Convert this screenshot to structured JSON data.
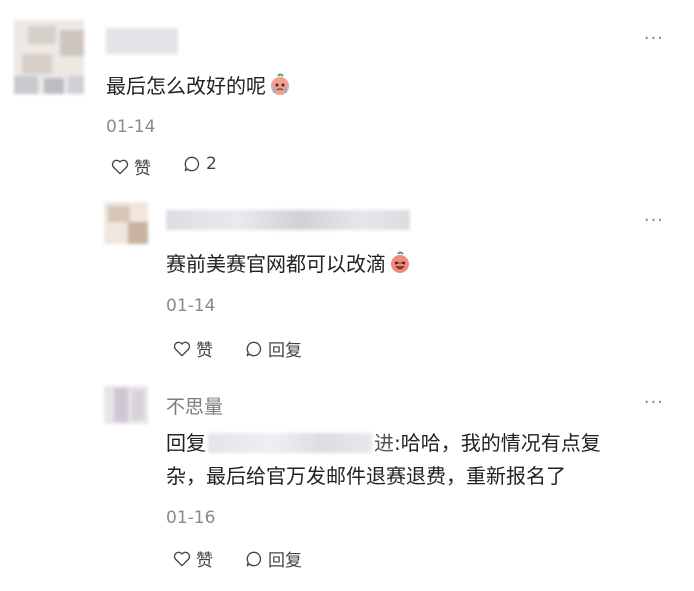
{
  "comments": [
    {
      "text": "最后怎么改好的呢",
      "emoji": "crying-peach-emoji",
      "date": "01-14",
      "like_label": "赞",
      "reply_count": "2"
    }
  ],
  "replies": [
    {
      "text": "赛前美赛官网都可以改滴",
      "emoji": "laughing-peach-emoji",
      "date": "01-14",
      "like_label": "赞",
      "reply_label": "回复"
    },
    {
      "username": "不思量",
      "reply_prefix": "回复",
      "reply_target_suffix": "进",
      "text_line1": ":哈哈，我的情况有点复",
      "text_line2": "杂，最后给官万发邮件退赛退费，重新报名了",
      "date": "01-16",
      "like_label": "赞",
      "reply_label": "回复"
    }
  ],
  "more_icon": "more-icon",
  "colors": {
    "text": "#222222",
    "meta": "#8a8a8a",
    "peach": "#f08a7a"
  }
}
